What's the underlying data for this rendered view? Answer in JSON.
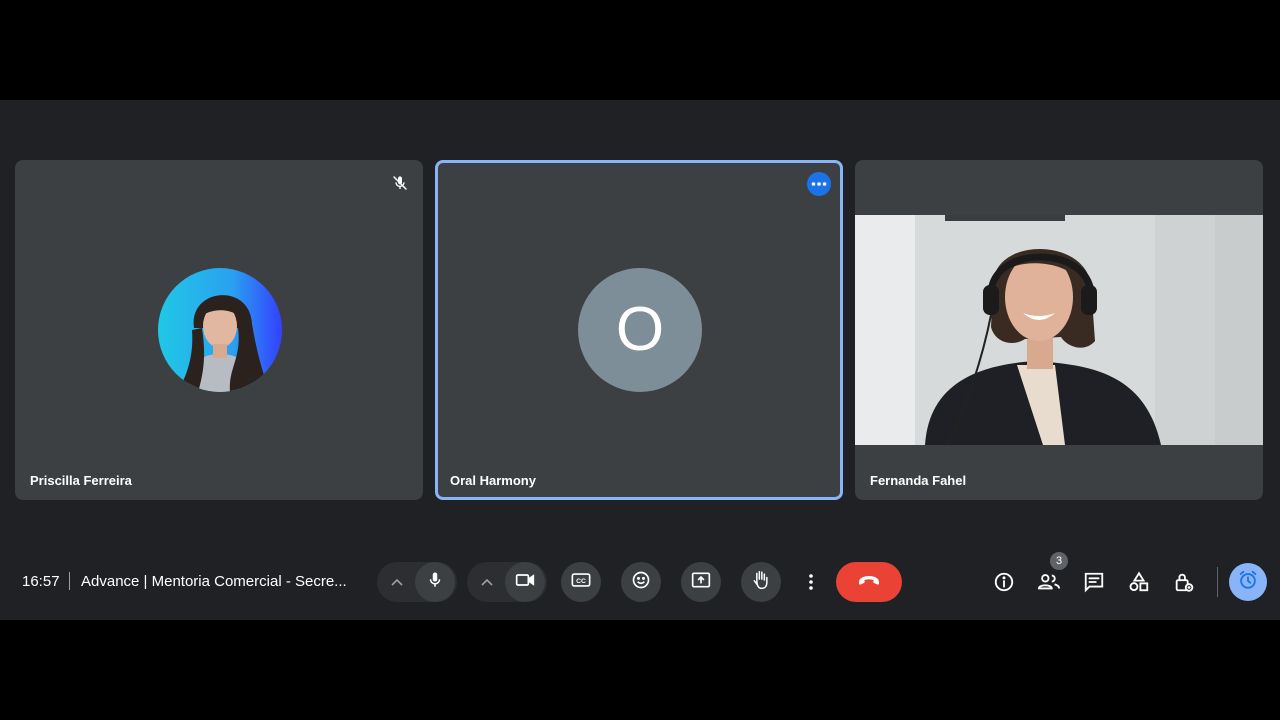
{
  "participants": [
    {
      "name": "Priscilla Ferreira",
      "muted": true
    },
    {
      "name": "Oral Harmony",
      "initial": "O",
      "avatar_color": "#7e8e98",
      "active_speaker": true
    },
    {
      "name": "Fernanda Fahel"
    }
  ],
  "control_bar": {
    "time": "16:57",
    "meeting_title": "Advance | Mentoria Comercial - Secre...",
    "people_count": "3"
  },
  "colors": {
    "end_call": "#ea4335",
    "highlight": "#8ab4f8",
    "accent": "#1a73e8"
  },
  "icons": [
    "mic-off-icon",
    "more-options-icon",
    "chevron-up-icon",
    "microphone-icon",
    "video-camera-icon",
    "captions-icon",
    "emoji-icon",
    "present-screen-icon",
    "raise-hand-icon",
    "more-vert-icon",
    "end-call-icon",
    "info-icon",
    "people-icon",
    "chat-icon",
    "activities-icon",
    "host-controls-icon",
    "timer-icon"
  ]
}
